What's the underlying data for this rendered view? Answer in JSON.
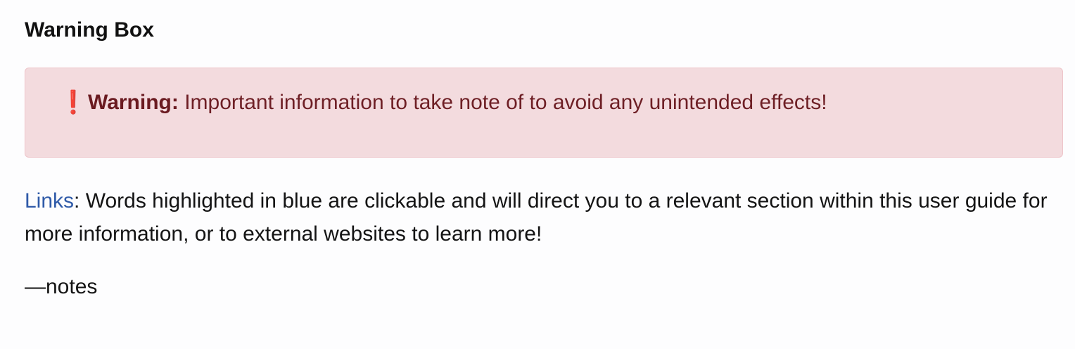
{
  "heading": "Warning Box",
  "warning": {
    "icon": "exclamation-icon",
    "icon_glyph": "❗",
    "label": "Warning:",
    "text": " Important information to take note of to avoid any unintended effects!",
    "colors": {
      "background": "#f3dbde",
      "border": "#eec5ca",
      "text": "#6e1f25",
      "icon": "#d22a2a"
    }
  },
  "links_paragraph": {
    "link_text": "Links",
    "text": ": Words highlighted in blue are clickable and will direct you to a relevant section within this user guide for more information, or to external websites to learn more!",
    "link_color": "#2f5aa8"
  },
  "notes": "—notes"
}
